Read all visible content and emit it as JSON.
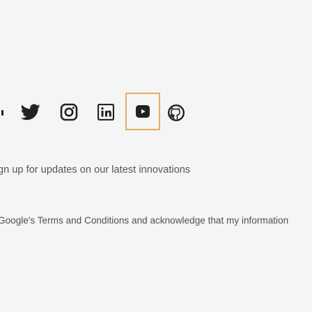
{
  "social": {
    "icons": [
      {
        "name": "partial-icon"
      },
      {
        "name": "twitter-icon"
      },
      {
        "name": "instagram-icon"
      },
      {
        "name": "linkedin-icon"
      },
      {
        "name": "youtube-icon",
        "focused": true,
        "focus_color": "#e5ac60"
      },
      {
        "name": "github-icon"
      }
    ],
    "icon_color": "#222222"
  },
  "newsletter": {
    "text": "gn up for updates on our latest innovations"
  },
  "legal": {
    "text": "Google's Terms and Conditions and acknowledge that my information"
  }
}
